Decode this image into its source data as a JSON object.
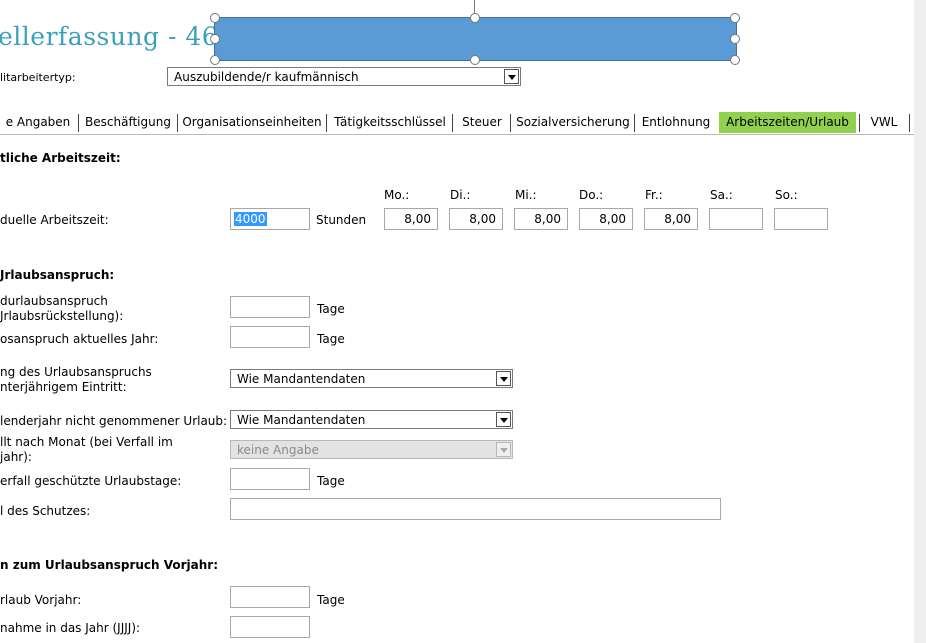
{
  "header": {
    "title": "ellerfassung - 46"
  },
  "employee_type": {
    "label": "litarbeitertyp:",
    "value": "Auszubildende/r kaufmännisch"
  },
  "tabs": [
    {
      "label": "e Angaben"
    },
    {
      "label": "Beschäftigung"
    },
    {
      "label": "Organisationseinheiten"
    },
    {
      "label": "Tätigkeitsschlüssel"
    },
    {
      "label": "Steuer"
    },
    {
      "label": "Sozialversicherung"
    },
    {
      "label": "Entlohnung"
    },
    {
      "label": "Arbeitszeiten/Urlaub"
    },
    {
      "label": "VWL"
    }
  ],
  "worktime": {
    "section_title": "tliche Arbeitszeit:",
    "label": "duelle Arbeitszeit:",
    "hours_value": "4000",
    "hours_unit": "Stunden",
    "days": [
      {
        "label": "Mo.:",
        "value": "8,00"
      },
      {
        "label": "Di.:",
        "value": "8,00"
      },
      {
        "label": "Mi.:",
        "value": "8,00"
      },
      {
        "label": "Do.:",
        "value": "8,00"
      },
      {
        "label": "Fr.:",
        "value": "8,00"
      },
      {
        "label": "Sa.:",
        "value": ""
      },
      {
        "label": "So.:",
        "value": ""
      }
    ]
  },
  "vacation": {
    "section_title": "Jrlaubsanspruch:",
    "base_label_1": "durlaubsanspruch",
    "base_label_2": "Jrlaubsrückstellung):",
    "base_unit": "Tage",
    "current_label": "osanspruch aktuelles Jahr:",
    "current_unit": "Tage",
    "calc_label_1": "ng des Urlaubsanspruchs",
    "calc_label_2": "nterjährigem Eintritt:",
    "calc_value": "Wie Mandantendaten",
    "notaken_label": "lenderjahr nicht genommener Urlaub:",
    "notaken_value": "Wie Mandantendaten",
    "expiry_label_1": "llt nach Monat (bei Verfall im",
    "expiry_label_2": "jahr):",
    "expiry_value": "keine Angabe",
    "protected_label": "erfall geschützte Urlaubstage:",
    "protected_unit": "Tage",
    "reason_label": "l des Schutzes:"
  },
  "prev_year": {
    "section_title": "n zum Urlaubsanspruch Vorjahr:",
    "vacation_label": "rlaub Vorjahr:",
    "vacation_unit": "Tage",
    "transfer_label": "nahme in das Jahr (JJJJ):"
  }
}
